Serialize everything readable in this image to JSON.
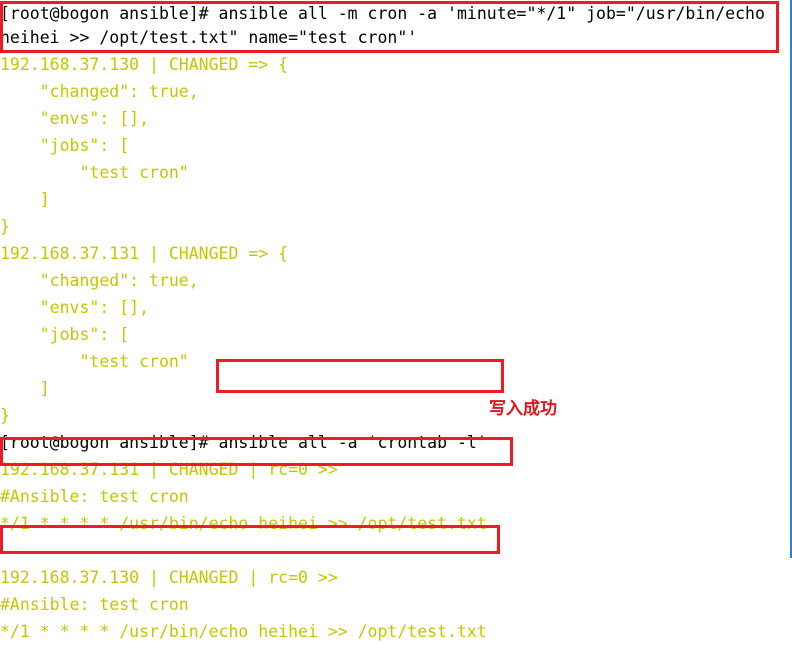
{
  "terminal": {
    "prompt": "[root@bogon ansible]# ",
    "fg_output": "#c6c600",
    "fg_command": "#000000",
    "background": "#ffffff",
    "annotation_color": "#ed1c24",
    "right_border_color": "#2f7fc4"
  },
  "lines": [
    {
      "id": "l01",
      "kind": "command",
      "text": "[root@bogon ansible]# ansible all -m cron -a 'minute=\"*/1\" job=\"/usr/bin/echo"
    },
    {
      "id": "l02",
      "kind": "command",
      "text": "heihei >> /opt/test.txt\" name=\"test cron\"'"
    },
    {
      "id": "l03",
      "kind": "output",
      "text": "192.168.37.130 | CHANGED => {"
    },
    {
      "id": "l04",
      "kind": "output",
      "text": "    \"changed\": true,"
    },
    {
      "id": "l05",
      "kind": "output",
      "text": "    \"envs\": [],"
    },
    {
      "id": "l06",
      "kind": "output",
      "text": "    \"jobs\": ["
    },
    {
      "id": "l07",
      "kind": "output",
      "text": "        \"test cron\""
    },
    {
      "id": "l08",
      "kind": "output",
      "text": "    ]"
    },
    {
      "id": "l09",
      "kind": "output",
      "text": "}"
    },
    {
      "id": "l10",
      "kind": "output",
      "text": "192.168.37.131 | CHANGED => {"
    },
    {
      "id": "l11",
      "kind": "output",
      "text": "    \"changed\": true,"
    },
    {
      "id": "l12",
      "kind": "output",
      "text": "    \"envs\": [],"
    },
    {
      "id": "l13",
      "kind": "output",
      "text": "    \"jobs\": ["
    },
    {
      "id": "l14",
      "kind": "output",
      "text": "        \"test cron\""
    },
    {
      "id": "l15",
      "kind": "output",
      "text": "    ]"
    },
    {
      "id": "l16",
      "kind": "output",
      "text": "}"
    },
    {
      "id": "l17",
      "kind": "command",
      "text": "[root@bogon ansible]# ansible all -a 'crontab -l'"
    },
    {
      "id": "l18",
      "kind": "output",
      "text": "192.168.37.131 | CHANGED | rc=0 >>"
    },
    {
      "id": "l19",
      "kind": "output",
      "text": "#Ansible: test cron"
    },
    {
      "id": "l20",
      "kind": "output",
      "text": "*/1 * * * * /usr/bin/echo heihei >> /opt/test.txt"
    },
    {
      "id": "l21",
      "kind": "blank",
      "text": " "
    },
    {
      "id": "l22",
      "kind": "output",
      "text": "192.168.37.130 | CHANGED | rc=0 >>"
    },
    {
      "id": "l23",
      "kind": "output",
      "text": "#Ansible: test cron"
    },
    {
      "id": "l24",
      "kind": "output",
      "text": "*/1 * * * * /usr/bin/echo heihei >> /opt/test.txt"
    }
  ],
  "annotations": {
    "note_text": "写入成功",
    "boxes": [
      {
        "id": "box-cron-create-command",
        "label": "highlight around the cron module command"
      },
      {
        "id": "box-crontab-list-command",
        "label": "highlight around the crontab -l command"
      },
      {
        "id": "box-crontab-entry-131",
        "label": "highlight around crontab entry on 192.168.37.131"
      },
      {
        "id": "box-crontab-entry-130",
        "label": "highlight around crontab entry on 192.168.37.130"
      }
    ]
  }
}
